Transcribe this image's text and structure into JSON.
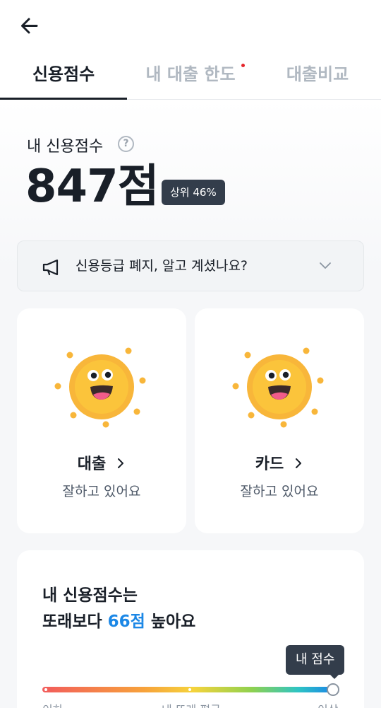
{
  "tabs": [
    {
      "label": "신용점수",
      "active": true
    },
    {
      "label": "내 대출 한도",
      "active": false,
      "has_new_dot": true
    },
    {
      "label": "대출비교",
      "active": false
    }
  ],
  "score": {
    "label": "내 신용점수",
    "value": "847점",
    "rank_badge": "상위 46%"
  },
  "notice": {
    "text": "신용등급 폐지, 알고 계셨나요?"
  },
  "cards": [
    {
      "title": "대출",
      "status": "잘하고 있어요"
    },
    {
      "title": "카드",
      "status": "잘하고 있어요"
    }
  ],
  "comparison": {
    "line1": "내 신용점수는",
    "line2_prefix": "또래보다 ",
    "line2_highlight": "66점",
    "line2_suffix": " 높아요",
    "tooltip": "내 점수",
    "axis_labels": {
      "low": "이하",
      "mid": "내 또래 평균",
      "high": "이상"
    },
    "my_position": 1.0
  },
  "colors": {
    "accent_blue": "#1b87e6",
    "dark_badge": "#333d4b",
    "new_dot": "#e5252a"
  }
}
